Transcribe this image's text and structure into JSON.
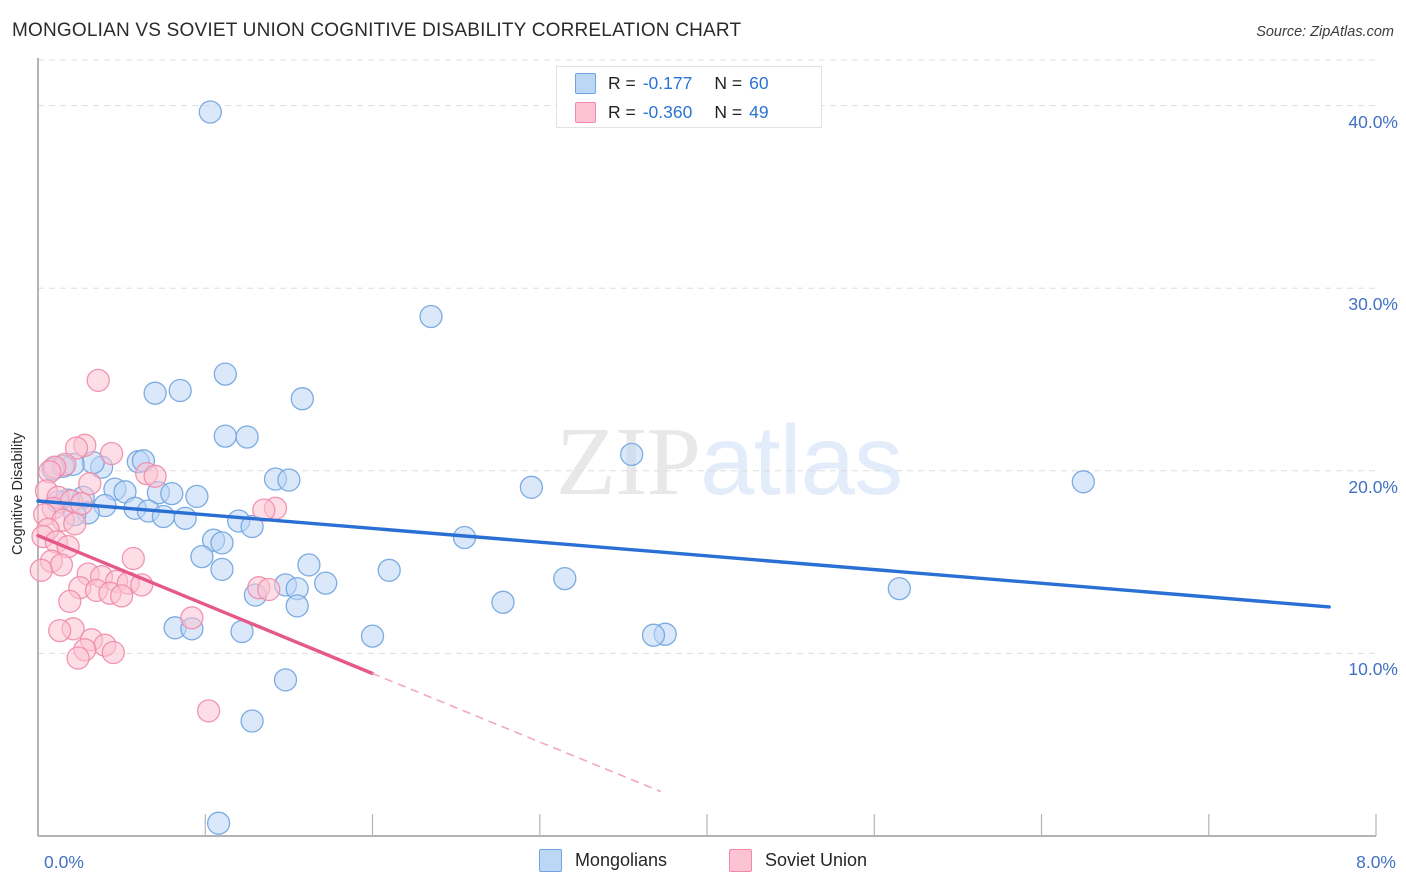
{
  "header": {
    "title": "MONGOLIAN VS SOVIET UNION COGNITIVE DISABILITY CORRELATION CHART",
    "source": "Source: ZipAtlas.com"
  },
  "watermark": {
    "part1": "ZIP",
    "part2": "atlas"
  },
  "legend_box": {
    "rows": [
      {
        "series": "Mongolians",
        "r_label": "R =",
        "r_value": "-0.177",
        "n_label": "N =",
        "n_value": "60",
        "color": "#bcd6f5"
      },
      {
        "series": "Soviet Union",
        "r_label": "R =",
        "r_value": "-0.360",
        "n_label": "N =",
        "n_value": "49",
        "color": "#fbc3d4"
      }
    ]
  },
  "bottom_legend": [
    {
      "label": "Mongolians",
      "color": "#bcd6f5"
    },
    {
      "label": "Soviet Union",
      "color": "#fbc3d4"
    }
  ],
  "axis": {
    "y_title": "Cognitive Disability",
    "y_ticks": [
      "40.0%",
      "30.0%",
      "20.0%",
      "10.0%"
    ],
    "x_ticks": [
      "0.0%",
      "8.0%"
    ]
  },
  "chart_data": {
    "type": "scatter",
    "title": "MONGOLIAN VS SOVIET UNION COGNITIVE DISABILITY CORRELATION CHART",
    "xlabel": "",
    "ylabel": "Cognitive Disability",
    "xlim": [
      0.0,
      8.0
    ],
    "ylim": [
      0.0,
      42.5
    ],
    "x_tick_values": [
      0.0,
      8.0
    ],
    "y_tick_values": [
      10.0,
      20.0,
      30.0,
      40.0
    ],
    "x_unit": "%",
    "y_unit": "%",
    "grid": "horizontal-dashed",
    "legend_position": "bottom-center",
    "series": [
      {
        "name": "Mongolians",
        "color": "#bcd6f5",
        "edge_color": "#6fa4de",
        "r": -0.177,
        "n": 60,
        "trendline": {
          "x0": 0.0,
          "y0": 18.35,
          "x1": 7.72,
          "y1": 12.55,
          "style": "solid",
          "color": "#2a6fd4"
        },
        "points": [
          [
            1.03,
            39.65
          ],
          [
            2.35,
            28.45
          ],
          [
            1.12,
            25.3
          ],
          [
            0.7,
            24.25
          ],
          [
            0.85,
            24.4
          ],
          [
            1.58,
            23.95
          ],
          [
            1.12,
            21.9
          ],
          [
            1.25,
            21.85
          ],
          [
            3.55,
            20.9
          ],
          [
            0.6,
            20.5
          ],
          [
            0.63,
            20.55
          ],
          [
            0.38,
            20.2
          ],
          [
            0.33,
            20.45
          ],
          [
            0.21,
            20.35
          ],
          [
            0.15,
            20.25
          ],
          [
            0.09,
            20.1
          ],
          [
            1.42,
            19.55
          ],
          [
            1.5,
            19.5
          ],
          [
            6.25,
            19.4
          ],
          [
            2.95,
            19.1
          ],
          [
            0.46,
            19.0
          ],
          [
            0.52,
            18.85
          ],
          [
            0.72,
            18.8
          ],
          [
            0.8,
            18.75
          ],
          [
            0.95,
            18.6
          ],
          [
            0.27,
            18.55
          ],
          [
            0.18,
            18.4
          ],
          [
            0.12,
            18.3
          ],
          [
            0.4,
            18.1
          ],
          [
            0.58,
            17.95
          ],
          [
            0.66,
            17.8
          ],
          [
            0.3,
            17.7
          ],
          [
            0.22,
            17.6
          ],
          [
            0.75,
            17.5
          ],
          [
            0.88,
            17.4
          ],
          [
            1.2,
            17.25
          ],
          [
            1.28,
            16.95
          ],
          [
            2.55,
            16.35
          ],
          [
            1.05,
            16.2
          ],
          [
            1.1,
            16.05
          ],
          [
            0.98,
            15.3
          ],
          [
            1.62,
            14.85
          ],
          [
            1.1,
            14.6
          ],
          [
            2.1,
            14.55
          ],
          [
            3.15,
            14.1
          ],
          [
            1.72,
            13.85
          ],
          [
            1.48,
            13.75
          ],
          [
            1.55,
            13.55
          ],
          [
            5.15,
            13.55
          ],
          [
            1.3,
            13.2
          ],
          [
            2.78,
            12.8
          ],
          [
            1.55,
            12.6
          ],
          [
            0.82,
            11.4
          ],
          [
            0.92,
            11.35
          ],
          [
            1.22,
            11.2
          ],
          [
            3.75,
            11.05
          ],
          [
            3.68,
            11.0
          ],
          [
            2.0,
            10.95
          ],
          [
            1.48,
            8.55
          ],
          [
            1.28,
            6.3
          ],
          [
            1.08,
            0.7
          ]
        ]
      },
      {
        "name": "Soviet Union",
        "color": "#fbc3d4",
        "edge_color": "#ef8ba9",
        "r": -0.36,
        "n": 49,
        "trendline": {
          "x0": 0.0,
          "y0": 16.45,
          "x1": 2.0,
          "y1": 8.9,
          "style": "solid",
          "color": "#e4588a"
        },
        "trendline_extension": {
          "x0": 2.0,
          "y0": 8.9,
          "x1": 3.72,
          "y1": 2.45,
          "style": "dashed",
          "color": "#f0a9c0"
        },
        "points": [
          [
            0.36,
            24.95
          ],
          [
            0.28,
            21.4
          ],
          [
            0.23,
            21.25
          ],
          [
            0.44,
            20.95
          ],
          [
            0.65,
            19.85
          ],
          [
            0.7,
            19.7
          ],
          [
            0.16,
            20.35
          ],
          [
            0.1,
            20.2
          ],
          [
            0.07,
            19.95
          ],
          [
            0.31,
            19.3
          ],
          [
            0.05,
            18.9
          ],
          [
            0.12,
            18.55
          ],
          [
            0.2,
            18.35
          ],
          [
            0.26,
            18.2
          ],
          [
            0.09,
            17.95
          ],
          [
            0.04,
            17.6
          ],
          [
            1.42,
            17.95
          ],
          [
            1.35,
            17.85
          ],
          [
            0.15,
            17.3
          ],
          [
            0.22,
            17.1
          ],
          [
            0.06,
            16.8
          ],
          [
            0.03,
            16.4
          ],
          [
            0.11,
            16.1
          ],
          [
            0.18,
            15.85
          ],
          [
            0.57,
            15.2
          ],
          [
            0.08,
            15.05
          ],
          [
            0.14,
            14.85
          ],
          [
            0.02,
            14.55
          ],
          [
            0.3,
            14.35
          ],
          [
            0.38,
            14.2
          ],
          [
            0.47,
            13.95
          ],
          [
            0.54,
            13.85
          ],
          [
            0.62,
            13.75
          ],
          [
            0.25,
            13.6
          ],
          [
            0.35,
            13.45
          ],
          [
            0.43,
            13.3
          ],
          [
            1.32,
            13.6
          ],
          [
            1.38,
            13.5
          ],
          [
            0.5,
            13.15
          ],
          [
            0.19,
            12.85
          ],
          [
            0.92,
            11.95
          ],
          [
            0.21,
            11.35
          ],
          [
            0.13,
            11.25
          ],
          [
            0.32,
            10.75
          ],
          [
            0.4,
            10.45
          ],
          [
            0.28,
            10.2
          ],
          [
            0.45,
            10.05
          ],
          [
            0.24,
            9.75
          ],
          [
            1.02,
            6.85
          ]
        ]
      }
    ]
  }
}
